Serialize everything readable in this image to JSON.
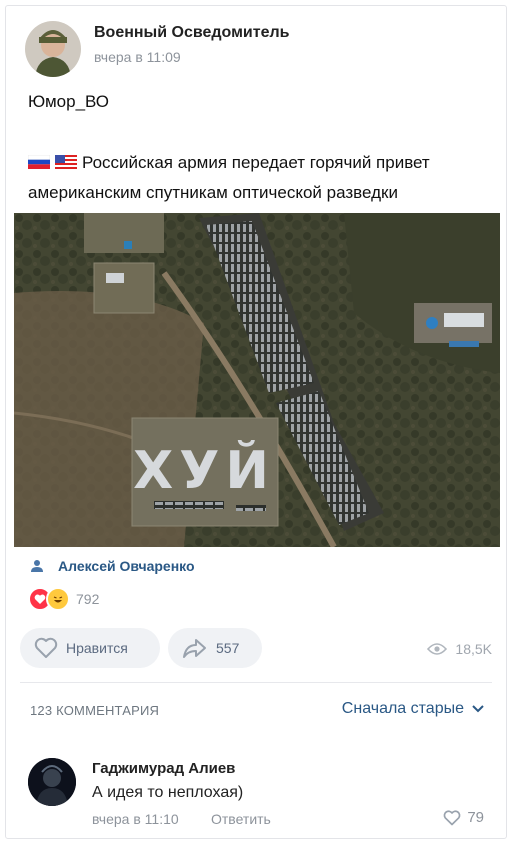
{
  "post": {
    "author_name": "Военный Осведомитель",
    "time": "вчера в 11:09",
    "line1": "Юмор_ВО",
    "line2": "Российская армия передает горячий привет американским спутникам оптической разведки",
    "image_text": "ХУЙ",
    "signer": "Алексей Овчаренко",
    "reactions_count": "792",
    "like_label": "Нравится",
    "share_count": "557",
    "views": "18,5K"
  },
  "comments": {
    "count_label": "123 КОММЕНТАРИЯ",
    "sort_label": "Сначала старые",
    "items": [
      {
        "author": "Гаджимурад Алиев",
        "text": "А идея то неплохая)",
        "time": "вчера в 11:10",
        "reply_label": "Ответить",
        "likes": "79"
      }
    ]
  },
  "colors": {
    "link": "#2a5885",
    "muted": "#8d939b",
    "button_bg": "#f0f2f5",
    "heart": "#ff3347"
  },
  "icons": [
    "person-icon",
    "heart-icon",
    "share-arrow-icon",
    "eye-icon",
    "chevron-down-icon",
    "russia-flag-icon",
    "usa-flag-icon",
    "heart-reaction-icon",
    "laugh-reaction-icon"
  ]
}
